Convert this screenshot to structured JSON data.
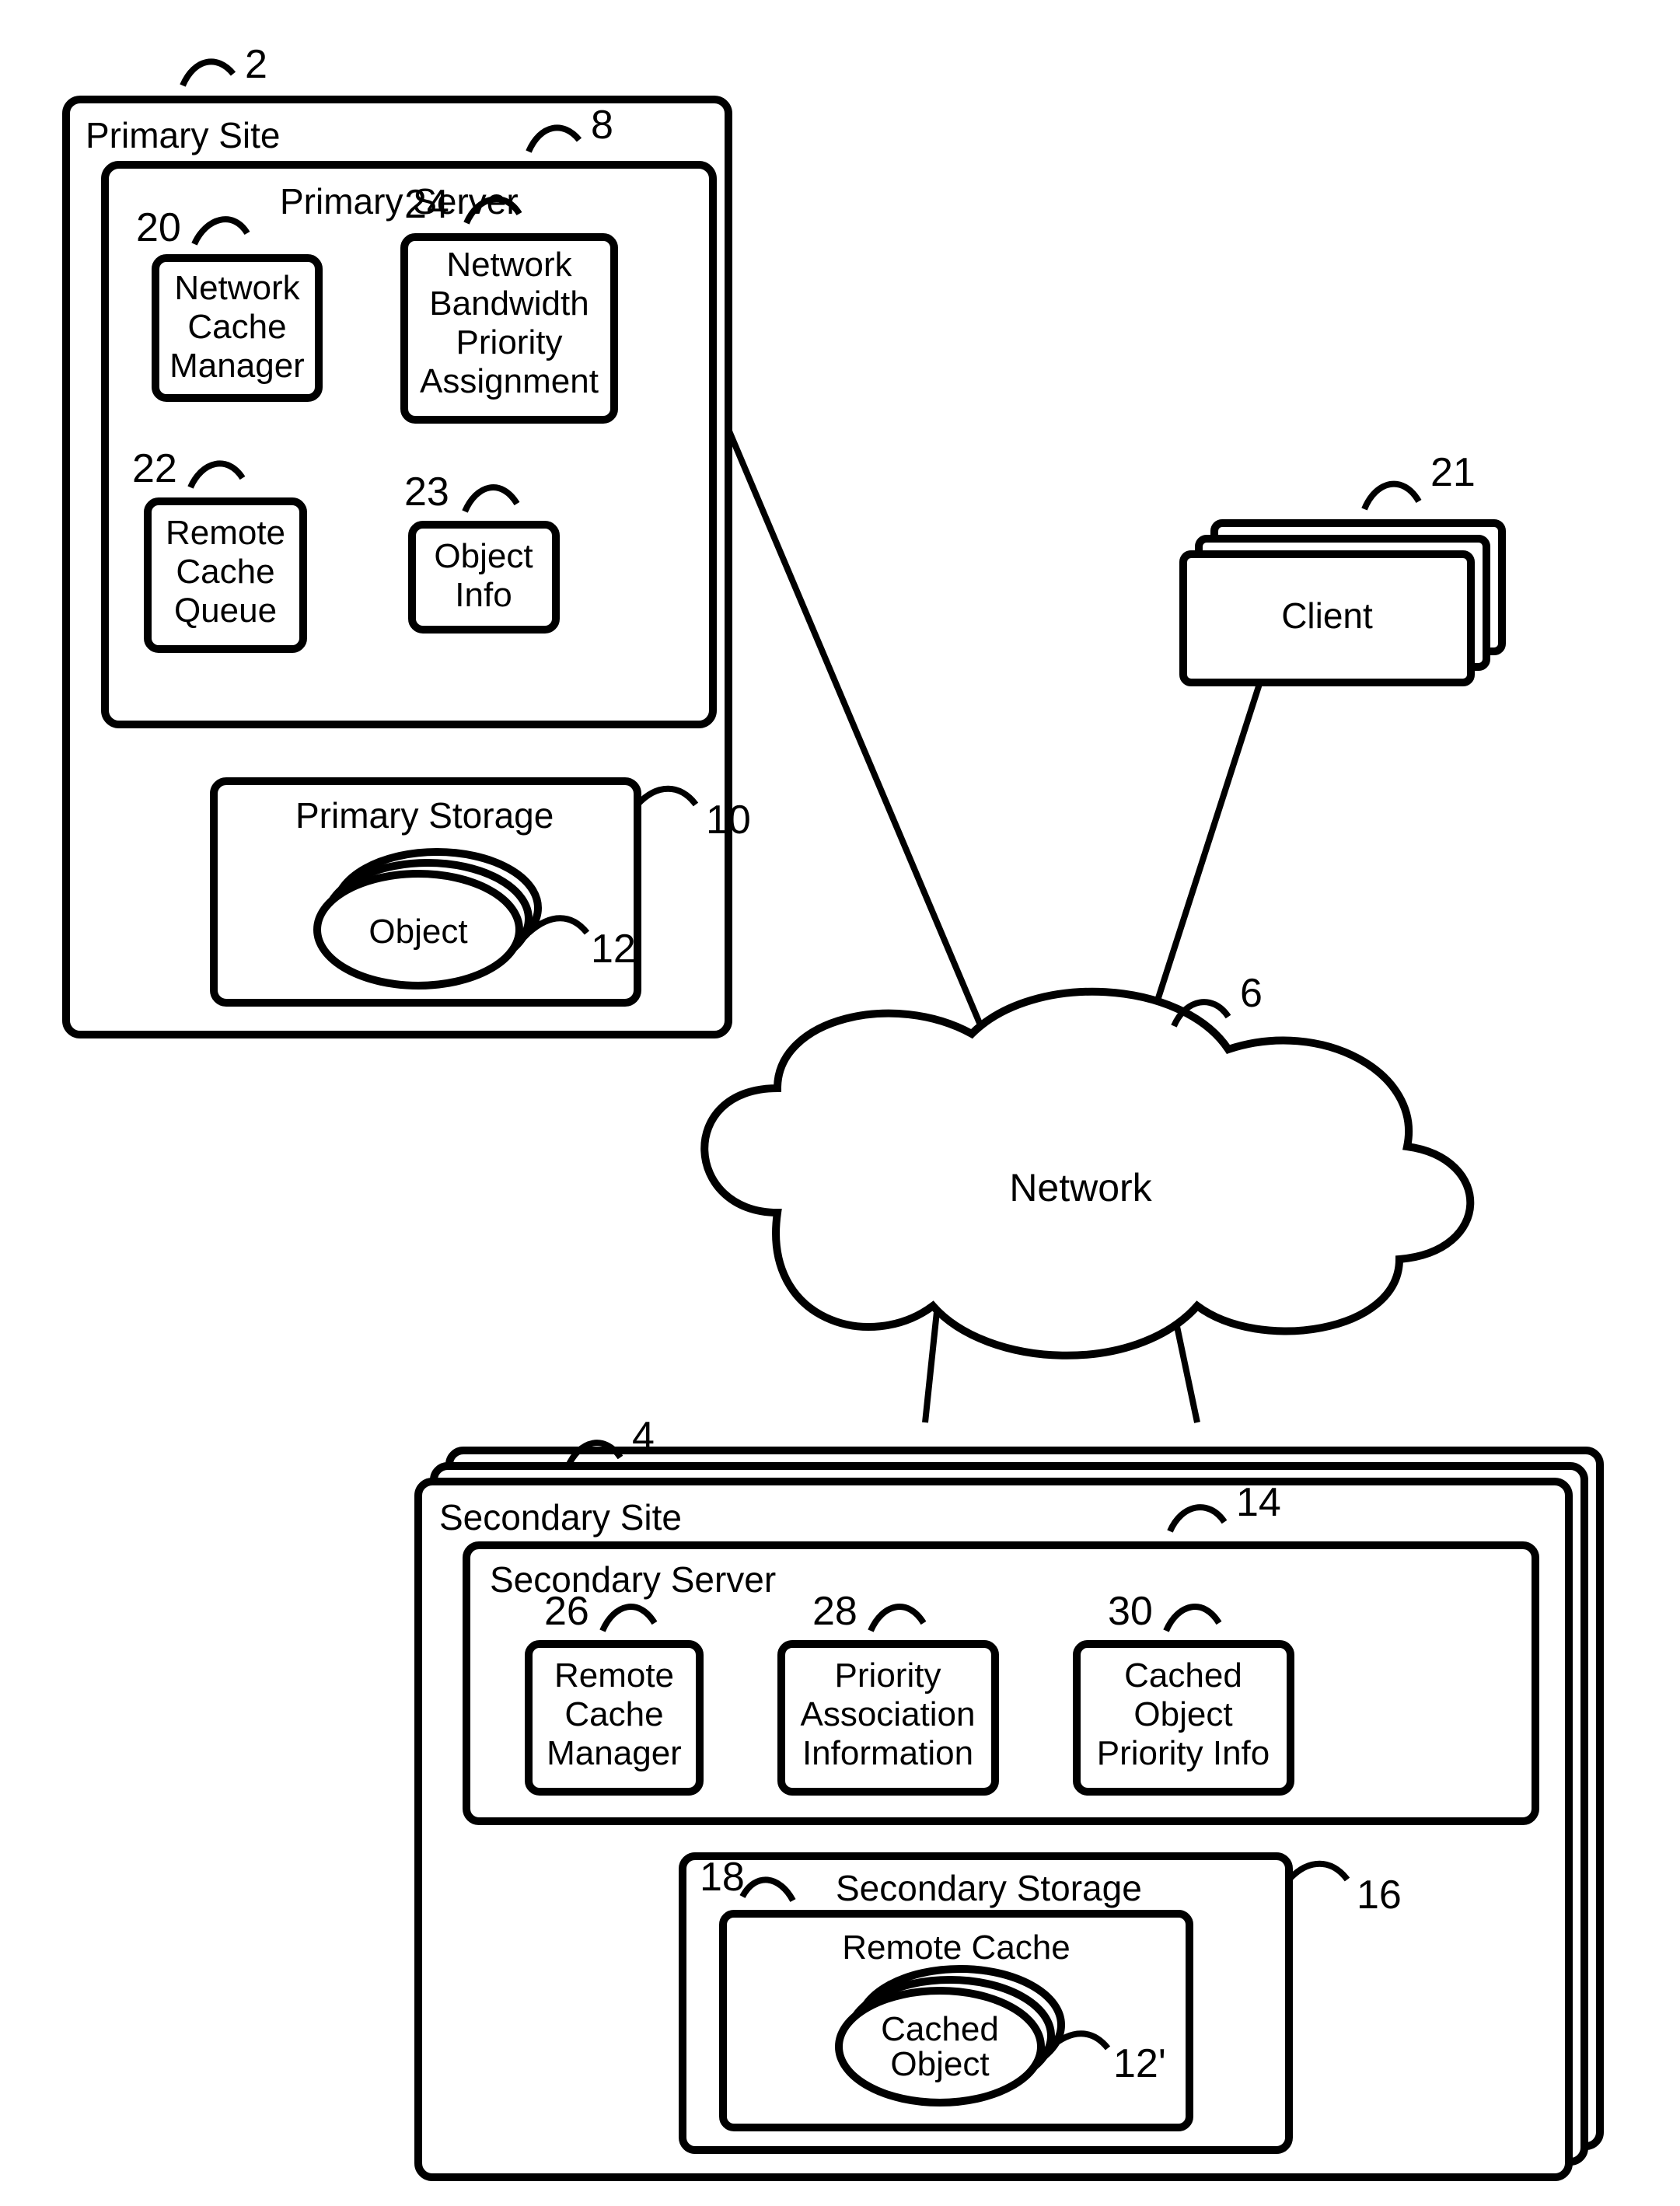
{
  "primarySite": {
    "label": "Primary Site",
    "ref": "2",
    "primaryServer": {
      "label": "Primary Server",
      "ref": "8",
      "networkCacheManager": {
        "label": [
          "Network",
          "Cache",
          "Manager"
        ],
        "ref": "20"
      },
      "networkBandwidth": {
        "label": [
          "Network",
          "Bandwidth",
          "Priority",
          "Assignment"
        ],
        "ref": "24"
      },
      "remoteCacheQueue": {
        "label": [
          "Remote",
          "Cache",
          "Queue"
        ],
        "ref": "22"
      },
      "objectInfo": {
        "label": [
          "Object",
          "Info"
        ],
        "ref": "23"
      }
    },
    "primaryStorage": {
      "label": "Primary Storage",
      "ref": "10",
      "object": {
        "label": "Object",
        "ref": "12"
      }
    }
  },
  "client": {
    "label": "Client",
    "ref": "21"
  },
  "network": {
    "label": "Network",
    "ref": "6"
  },
  "secondarySite": {
    "label": "Secondary Site",
    "ref": "4",
    "secondaryServer": {
      "label": "Secondary Server",
      "ref": "14",
      "remoteCacheManager": {
        "label": [
          "Remote",
          "Cache",
          "Manager"
        ],
        "ref": "26"
      },
      "priorityAssoc": {
        "label": [
          "Priority",
          "Association",
          "Information"
        ],
        "ref": "28"
      },
      "cachedObjPriority": {
        "label": [
          "Cached",
          "Object",
          "Priority Info"
        ],
        "ref": "30"
      }
    },
    "secondaryStorage": {
      "label": "Secondary Storage",
      "ref": "16",
      "remoteCache": {
        "label": "Remote Cache",
        "ref": "18"
      },
      "cachedObject": {
        "label": [
          "Cached",
          "Object"
        ],
        "ref": "12'"
      }
    }
  }
}
